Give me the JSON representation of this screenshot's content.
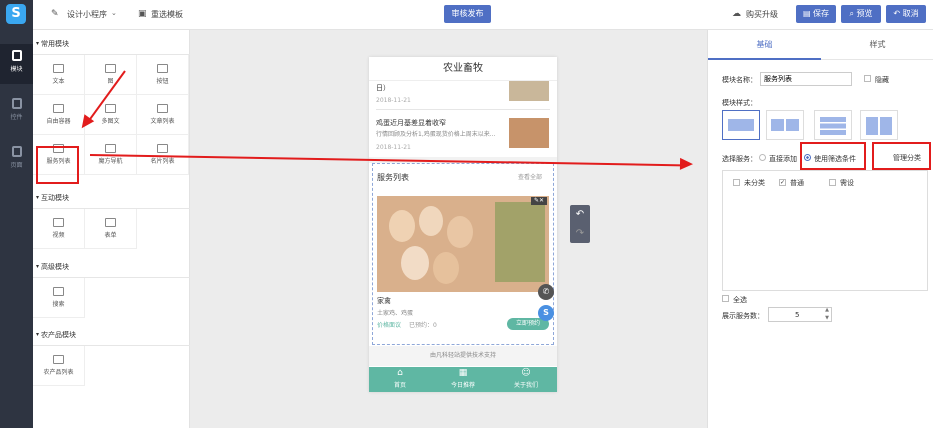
{
  "rail": {
    "items": [
      {
        "label": "模块"
      },
      {
        "label": "控件"
      },
      {
        "label": "页面"
      }
    ]
  },
  "topbar": {
    "design_label": "设计小程序",
    "reselect_label": "重选模板",
    "submit_label": "审核发布",
    "upgrade_label": "购买升级",
    "save_label": "保存",
    "preview_label": "预览",
    "cancel_label": "取消"
  },
  "left_panel": {
    "sections": [
      {
        "title": "常用模块",
        "items": [
          "文本",
          "图",
          "按钮",
          "自由容器",
          "多图文",
          "文章列表",
          "服务列表",
          "魔方导航",
          "名片列表"
        ]
      },
      {
        "title": "互动模块",
        "items": [
          "视频",
          "表单"
        ]
      },
      {
        "title": "高级模块",
        "items": [
          "搜索"
        ]
      },
      {
        "title": "农产品模块",
        "items": [
          "农产品列表"
        ]
      }
    ]
  },
  "phone": {
    "title": "农业畜牧",
    "articles": [
      {
        "title": "日）",
        "date": "2018-11-21"
      },
      {
        "title": "鸡蛋近月基差显着收窄",
        "desc": "行情回顾及分析1,鸡蛋现货价格上周末以来...",
        "date": "2018-11-21"
      }
    ],
    "service_section_title": "服务列表",
    "view_all": "查看全部",
    "service": {
      "name": "家禽",
      "tags": "土家鸡、鸡蛋",
      "price": "价格面议",
      "booked": "已预约：0",
      "book_button": "立即预约"
    },
    "footer_note": "由凡科轻站提供技术支持",
    "tabs": [
      {
        "label": "首页"
      },
      {
        "label": "今日推荐"
      },
      {
        "label": "关于我们"
      }
    ],
    "tab_color": "#5fb7a3"
  },
  "right_panel": {
    "tabs": [
      "基础",
      "样式"
    ],
    "module_name_label": "模块名称：",
    "module_name_value": "服务列表",
    "hide_label": "隐藏",
    "style_label": "模块样式：",
    "select_service_label": "选择服务：",
    "direct_add_label": "直接添加",
    "filter_label": "使用筛选条件",
    "manage_label": "管理分类",
    "categories": [
      {
        "label": "未分类",
        "checked": false
      },
      {
        "label": "普通",
        "checked": true
      },
      {
        "label": "需设",
        "checked": false
      }
    ],
    "select_all_label": "全选",
    "show_count_label": "展示服务数：",
    "show_count_value": "5"
  },
  "colors": {
    "accent": "#4f6fc4",
    "annotation": "#e21c1c",
    "rail": "#2e3441"
  }
}
